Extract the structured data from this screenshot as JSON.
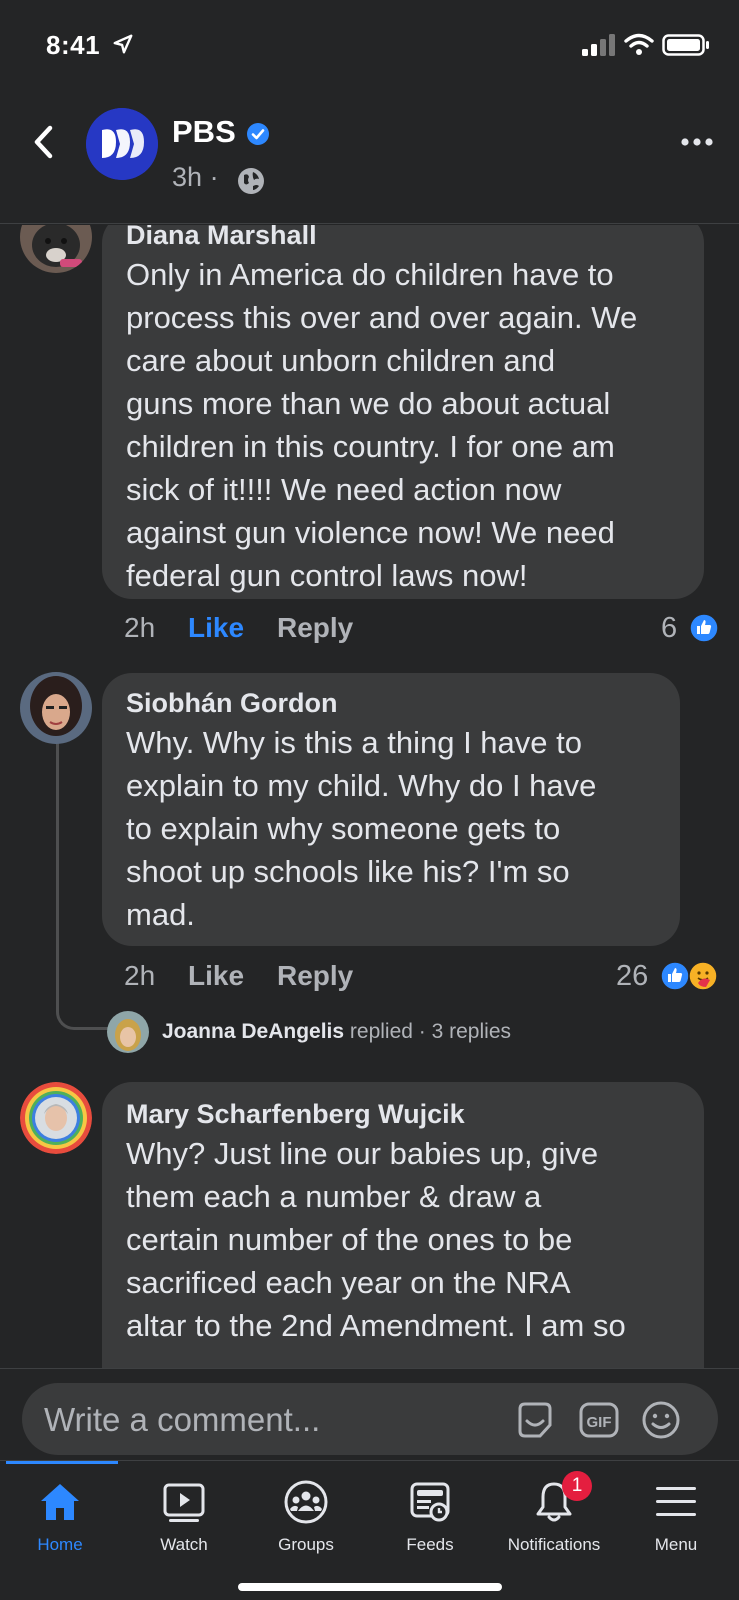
{
  "status_bar": {
    "time": "8:41"
  },
  "header": {
    "page_name": "PBS",
    "time_ago": "3h",
    "dot": "·"
  },
  "comments": [
    {
      "author": "Diana Marshall",
      "text": "Only in America do children have to\nprocess this over and over again. We\ncare about unborn children and\nguns more than we do about actual\nchildren in this country.  I for one am\nsick of it!!!!  We need action now\nagainst gun violence now! We need\nfederal gun control laws now!",
      "time": "2h",
      "like_label": "Like",
      "reply_label": "Reply",
      "reactions": "6",
      "liked": true
    },
    {
      "author": "Siobhán Gordon",
      "text": "Why. Why is this a thing I have to\nexplain to my child.  Why do I have\nto explain why someone gets to\nshoot up schools like his?  I'm so\nmad.",
      "time": "2h",
      "like_label": "Like",
      "reply_label": "Reply",
      "reactions": "26",
      "liked": false,
      "replies": {
        "name": "Joanna DeAngelis",
        "action": "replied",
        "count": "· 3 replies"
      }
    },
    {
      "author": "Mary Scharfenberg Wujcik",
      "text": "Why? Just line our babies up, give\nthem each a number & draw a\ncertain number of the ones to be\nsacrificed each year on the NRA\naltar to the 2nd Amendment. I am so",
      "time": "",
      "like_label": "",
      "reply_label": "",
      "reactions": ""
    }
  ],
  "comment_input": {
    "placeholder": "Write a comment..."
  },
  "nav": {
    "items": [
      {
        "label": "Home",
        "icon": "home-icon",
        "active": true
      },
      {
        "label": "Watch",
        "icon": "watch-icon"
      },
      {
        "label": "Groups",
        "icon": "groups-icon"
      },
      {
        "label": "Feeds",
        "icon": "feeds-icon"
      },
      {
        "label": "Notifications",
        "icon": "bell-icon",
        "badge": "1"
      },
      {
        "label": "Menu",
        "icon": "menu-icon"
      }
    ]
  },
  "colors": {
    "accent": "#2d88ff",
    "badge": "#e41e3f",
    "background": "#242526",
    "bubble": "#3a3b3c"
  }
}
